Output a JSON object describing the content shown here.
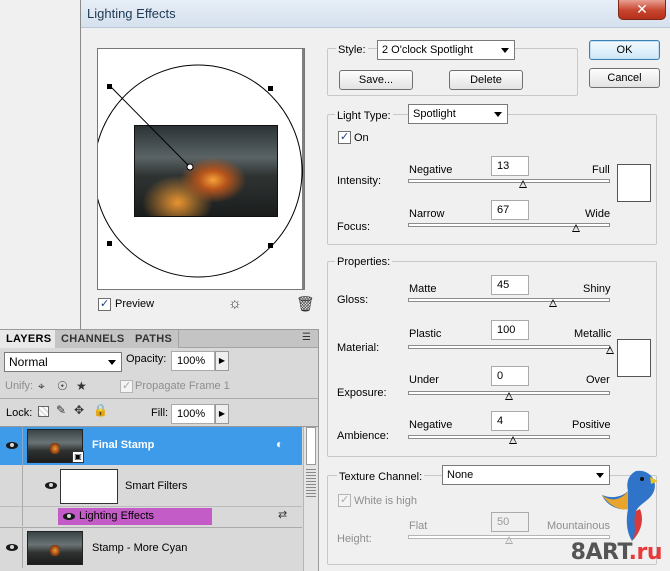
{
  "dialog": {
    "title": "Lighting Effects",
    "close_label": "✕",
    "ok_label": "OK",
    "cancel_label": "Cancel"
  },
  "style": {
    "label": "Style:",
    "value": "2 O'clock Spotlight",
    "save_label": "Save...",
    "delete_label": "Delete"
  },
  "light_type": {
    "label": "Light Type:",
    "value": "Spotlight",
    "on_label": "On",
    "on_checked": true,
    "intensity": {
      "label": "Intensity:",
      "min_label": "Negative",
      "max_label": "Full",
      "value": "13",
      "fraction": 0.57
    },
    "focus": {
      "label": "Focus:",
      "min_label": "Narrow",
      "max_label": "Wide",
      "value": "67",
      "fraction": 0.83
    },
    "light_color": "#ffffff"
  },
  "properties": {
    "label": "Properties:",
    "gloss": {
      "label": "Gloss:",
      "min_label": "Matte",
      "max_label": "Shiny",
      "value": "45",
      "fraction": 0.72
    },
    "material": {
      "label": "Material:",
      "min_label": "Plastic",
      "max_label": "Metallic",
      "value": "100",
      "fraction": 1.0
    },
    "exposure": {
      "label": "Exposure:",
      "min_label": "Under",
      "max_label": "Over",
      "value": "0",
      "fraction": 0.5
    },
    "ambience": {
      "label": "Ambience:",
      "min_label": "Negative",
      "max_label": "Positive",
      "value": "4",
      "fraction": 0.52
    },
    "ambient_color": "#ffffff"
  },
  "texture": {
    "label": "Texture Channel:",
    "value": "None",
    "white_is_high_label": "White is high",
    "height": {
      "label": "Height:",
      "min_label": "Flat",
      "max_label": "Mountainous",
      "value": "50",
      "fraction": 0.5
    }
  },
  "preview": {
    "label": "Preview",
    "checked": true
  },
  "layers_panel": {
    "tabs": [
      "LAYERS",
      "CHANNELS",
      "PATHS"
    ],
    "blend_mode": "Normal",
    "opacity_label": "Opacity:",
    "opacity_value": "100%",
    "unify_label": "Unify:",
    "propagate_label": "Propagate Frame 1",
    "lock_label": "Lock:",
    "fill_label": "Fill:",
    "fill_value": "100%",
    "layers": [
      {
        "name": "Final Stamp",
        "selected": true
      },
      {
        "name": "Smart Filters",
        "selected": false
      },
      {
        "name": "Lighting Effects",
        "selected": false
      },
      {
        "name": "Stamp - More Cyan",
        "selected": false
      }
    ]
  },
  "watermark": {
    "main": "8ART",
    "suffix": ".ru"
  },
  "colors": {
    "selected_layer": "#3d9bea",
    "filter_highlight": "#c45cc8"
  }
}
